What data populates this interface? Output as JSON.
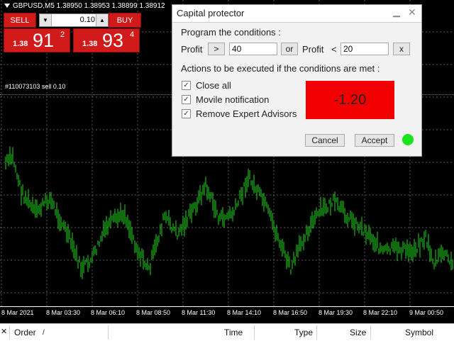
{
  "chart": {
    "symbol_line": "GBPUSD,M5  1.38950 1.38953 1.38899 1.38912",
    "position_label": "#110073103 sell 0.10",
    "time_axis": [
      "8 Mar 2021",
      "8 Mar 03:30",
      "8 Mar 06:10",
      "8 Mar 08:50",
      "8 Mar 11:30",
      "8 Mar 14:10",
      "8 Mar 16:50",
      "8 Mar 19:30",
      "8 Mar 22:10",
      "9 Mar 00:50"
    ]
  },
  "trade_panel": {
    "sell_label": "SELL",
    "buy_label": "BUY",
    "lot_value": "0.10",
    "sell_price": {
      "prefix": "1.38",
      "big": "91",
      "sup": "2"
    },
    "buy_price": {
      "prefix": "1.38",
      "big": "93",
      "sup": "4"
    },
    "colors": {
      "sell": "#d11b1b",
      "buy": "#d11b1b"
    }
  },
  "dialog": {
    "title": "Capital protector",
    "program_heading": "Program the conditions :",
    "profit_label_1": "Profit",
    "gt_button": ">",
    "profit_value_1": "40",
    "or_button": "or",
    "profit_label_2": "Profit",
    "lt_symbol": "<",
    "profit_value_2": "20",
    "x_button": "x",
    "actions_heading": "Actions to be executed if the conditions are met :",
    "options": [
      {
        "label": "Close all",
        "checked": true
      },
      {
        "label": "Movile notification",
        "checked": true
      },
      {
        "label": "Remove Expert Advisors",
        "checked": true
      }
    ],
    "result_value": "-1.20",
    "result_color": "#f20000",
    "cancel_label": "Cancel",
    "accept_label": "Accept",
    "status_color": "#1be41b"
  },
  "toolbox": {
    "columns": [
      "Order",
      "/",
      "Time",
      "Type",
      "Size",
      "Symbol"
    ]
  },
  "icons": [
    "close-icon",
    "minimize-icon",
    "dropdown-icon",
    "check-icon",
    "status-dot-icon"
  ]
}
